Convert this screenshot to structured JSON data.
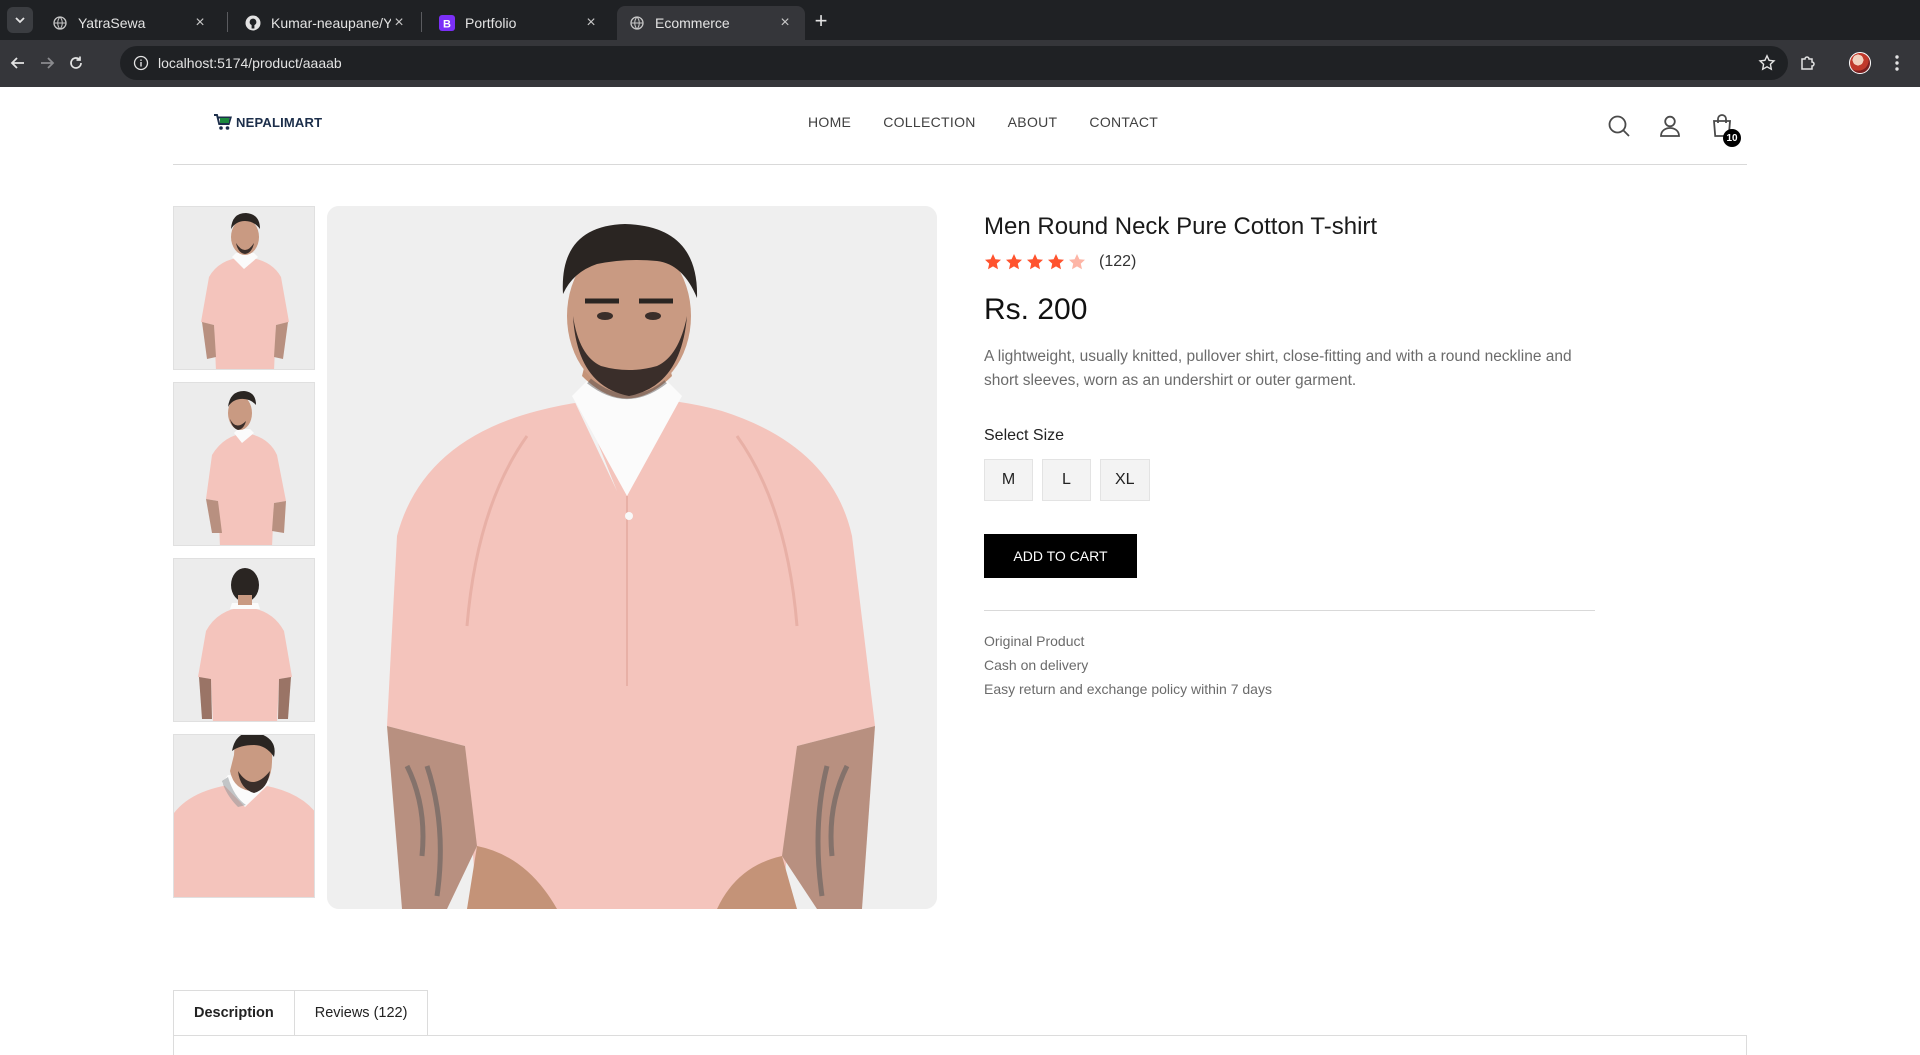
{
  "browser": {
    "tabs": [
      {
        "title": "YatraSewa",
        "icon": "globe-icon"
      },
      {
        "title": "Kumar-neaupane/YatraS",
        "icon": "github-icon"
      },
      {
        "title": "Portfolio",
        "icon": "bootstrap-icon"
      },
      {
        "title": "Ecommerce",
        "icon": "globe-icon",
        "active": true
      }
    ],
    "url": "localhost:5174/product/aaaab"
  },
  "header": {
    "logo_text": "NEPALIMART",
    "nav": [
      "HOME",
      "COLLECTION",
      "ABOUT",
      "CONTACT"
    ],
    "cart_count": "10"
  },
  "product": {
    "title": "Men Round Neck Pure Cotton T-shirt",
    "rating": 4,
    "rating_max": 5,
    "review_count": "(122)",
    "price": "Rs. 200",
    "description": "A lightweight, usually knitted, pullover shirt, close-fitting and with a round neckline and short sleeves, worn as an undershirt or outer garment.",
    "size_label": "Select Size",
    "sizes": [
      "M",
      "L",
      "XL"
    ],
    "add_to_cart": "ADD TO CART",
    "policies": [
      "Original Product",
      "Cash on delivery",
      "Easy return and exchange policy within 7 days"
    ]
  },
  "tabs": {
    "description": "Description",
    "reviews": "Reviews (122)"
  },
  "colors": {
    "star": "#ff532e",
    "star_empty": "#fdb5a6",
    "shirt": "#f4c4bc",
    "button": "#000000"
  }
}
